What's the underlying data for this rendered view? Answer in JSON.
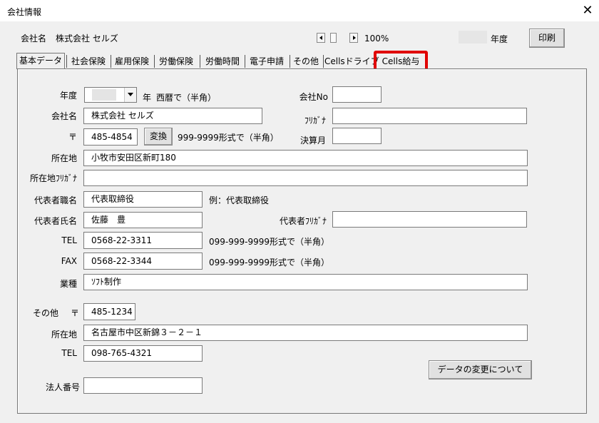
{
  "window": {
    "title": "会社情報",
    "close": "✕"
  },
  "header": {
    "company_label": "会社名",
    "company_name": "株式会社 セルズ",
    "zoom": "100%",
    "year_suffix": "年度",
    "print_label": "印刷"
  },
  "tabs": [
    {
      "label": "基本データ"
    },
    {
      "label": "社会保険"
    },
    {
      "label": "雇用保険"
    },
    {
      "label": "労働保険"
    },
    {
      "label": "労働時間"
    },
    {
      "label": "電子申請"
    },
    {
      "label": "その他"
    },
    {
      "label": "Cellsドライブ"
    },
    {
      "label": "Cells給与"
    }
  ],
  "highlight_color": "#e00000",
  "form": {
    "year_label": "年度",
    "year_value": "",
    "year_suffix": "年",
    "year_hint": "西暦で（半角）",
    "company_no_label": "会社No",
    "company_no_value": "",
    "name_label": "会社名",
    "name_value": "株式会社 セルズ",
    "furigana_label": "ﾌﾘｶﾞﾅ",
    "furigana_value": "",
    "postal_label": "〒",
    "postal_value": "485-4854",
    "convert_label": "変換",
    "postal_hint": "999-9999形式で（半角）",
    "fiscal_month_label": "決算月",
    "fiscal_month_value": "",
    "address_label": "所在地",
    "address_value": "小牧市安田区新町180",
    "address_kana_label": "所在地ﾌﾘｶﾞﾅ",
    "address_kana_value": "",
    "rep_title_label": "代表者職名",
    "rep_title_value": "代表取締役",
    "rep_title_hint": "例：代表取締役",
    "rep_name_label": "代表者氏名",
    "rep_name_value": "佐藤　豊",
    "rep_kana_label": "代表者ﾌﾘｶﾞﾅ",
    "rep_kana_value": "",
    "tel_label": "TEL",
    "tel_value": "0568-22-3311",
    "tel_hint": "099-999-9999形式で（半角）",
    "fax_label": "FAX",
    "fax_value": "0568-22-3344",
    "fax_hint": "099-999-9999形式で（半角）",
    "industry_label": "業種",
    "industry_value": "ｿﾌﾄ制作",
    "other_label": "その他",
    "other_postal_label": "〒",
    "other_postal_value": "485-1234",
    "other_address_label": "所在地",
    "other_address_value": "名古屋市中区新錦３－２－１",
    "other_tel_label": "TEL",
    "other_tel_value": "098-765-4321",
    "corp_no_label": "法人番号",
    "corp_no_value": "",
    "change_button_label": "データの変更について"
  }
}
